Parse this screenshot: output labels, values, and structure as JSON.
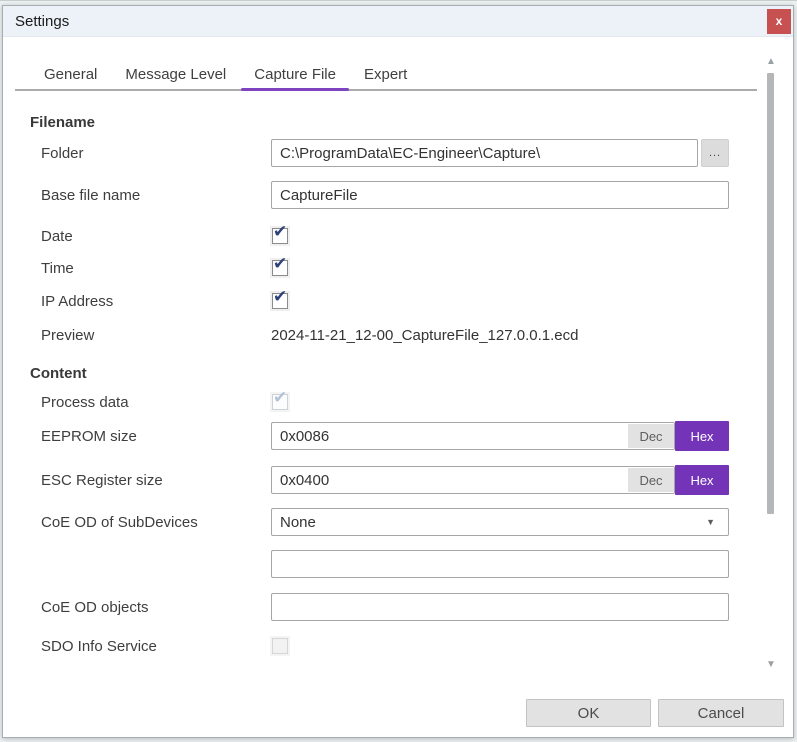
{
  "window": {
    "title": "Settings",
    "close_glyph": "x"
  },
  "tabs": {
    "general": "General",
    "message_level": "Message Level",
    "capture_file": "Capture File",
    "expert": "Expert",
    "active": "Capture File"
  },
  "filename": {
    "header": "Filename",
    "folder_label": "Folder",
    "folder_value": "C:\\ProgramData\\EC-Engineer\\Capture\\",
    "browse_label": "...",
    "base_label": "Base file name",
    "base_value": "CaptureFile",
    "date_label": "Date",
    "date_checked": "true",
    "time_label": "Time",
    "time_checked": "true",
    "ip_label": "IP Address",
    "ip_checked": "true",
    "preview_label": "Preview",
    "preview_value": "2024-11-21_12-00_CaptureFile_127.0.0.1.ecd"
  },
  "content": {
    "header": "Content",
    "process_label": "Process data",
    "process_checked": "true (disabled)",
    "eeprom_label": "EEPROM size",
    "eeprom_value": "0x0086",
    "esc_label": "ESC Register size",
    "esc_value": "0x0400",
    "dec_label": "Dec",
    "hex_label": "Hex",
    "radix_selected": "Hex",
    "coe_od_label": "CoE OD of SubDevices",
    "coe_od_value": "None",
    "coe_filter_value": "",
    "coe_objects_label": "CoE OD objects",
    "coe_objects_value": "",
    "sdo_label": "SDO Info Service",
    "sdo_checked": "false (disabled)"
  },
  "footer": {
    "ok": "OK",
    "cancel": "Cancel"
  },
  "icons": {
    "check": "✔",
    "dropdown_arrow": "▼",
    "scroll_up": "▲",
    "scroll_down": "▼"
  },
  "colors": {
    "accent_purple": "#7434b7",
    "tab_underline_purple": "#7e44c0",
    "close_red": "#c75050",
    "check_navy": "#2d3f7d",
    "titlebar_bg": "#ecf2f8"
  }
}
